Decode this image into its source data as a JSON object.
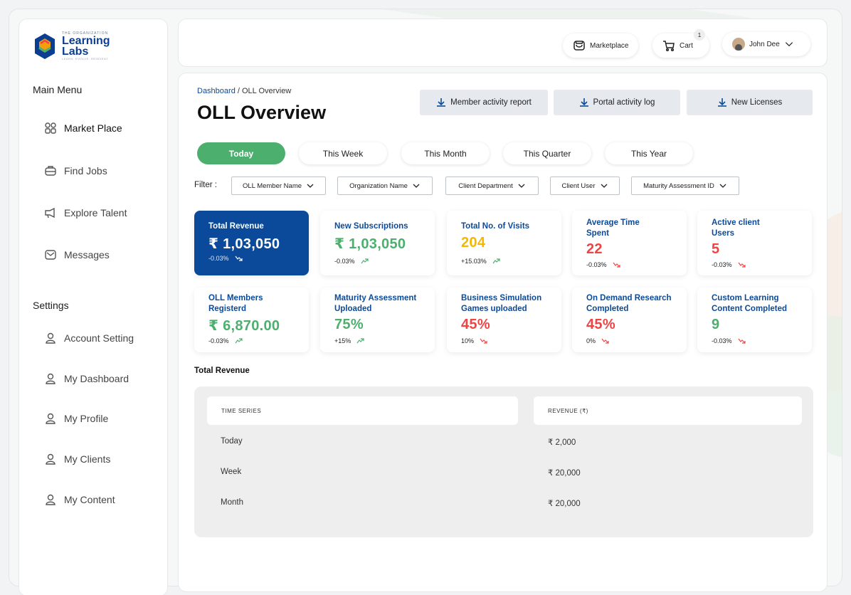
{
  "brand": {
    "small": "THE ORGANIZATION",
    "name_line1": "Learning",
    "name_line2": "Labs",
    "tagline": "LEARN. EVOLVE. REINVENT"
  },
  "sidebar": {
    "main_title": "Main Menu",
    "main_items": [
      {
        "label": "Market Place",
        "icon": "grid-icon"
      },
      {
        "label": "Find Jobs",
        "icon": "briefcase-icon"
      },
      {
        "label": "Explore Talent",
        "icon": "megaphone-icon"
      },
      {
        "label": "Messages",
        "icon": "message-icon"
      }
    ],
    "settings_title": "Settings",
    "settings_items": [
      {
        "label": "Account Setting",
        "icon": "user-icon"
      },
      {
        "label": "My Dashboard",
        "icon": "user-icon"
      },
      {
        "label": "My Profile",
        "icon": "user-icon"
      },
      {
        "label": "My Clients",
        "icon": "user-icon"
      },
      {
        "label": "My Content",
        "icon": "user-icon"
      }
    ]
  },
  "header": {
    "marketplace_label": "Marketplace",
    "cart_label": "Cart",
    "cart_count": "1",
    "user_name": "John Dee"
  },
  "main": {
    "breadcrumb_root": "Dashboard",
    "breadcrumb_sep": " / ",
    "breadcrumb_current": "OLL Overview",
    "title": "OLL Overview",
    "downloads": [
      "Member activity report",
      "Portal activity log",
      "New Licenses"
    ],
    "periods": [
      "Today",
      "This Week",
      "This Month",
      "This Quarter",
      "This Year"
    ],
    "active_period": "Today",
    "filter_label": "Filter :",
    "filters": [
      "OLL Member Name",
      "Organization Name",
      "Client Department",
      "Client User",
      "Maturity Assessment ID"
    ],
    "cards": [
      {
        "label": "Total Revenue",
        "value": "₹ 1,03,050",
        "change": "-0.03%",
        "trend": "down",
        "color": "#ffffff"
      },
      {
        "label": "New Subscriptions",
        "value": "₹ 1,03,050",
        "change": "-0.03%",
        "trend": "up",
        "color": "#4caf6e"
      },
      {
        "label": "Total No. of Visits",
        "value": "204",
        "change": "+15.03%",
        "trend": "up",
        "color": "#f5b700"
      },
      {
        "label": "Average Time Spent",
        "value": "22",
        "change": "-0.03%",
        "trend": "down",
        "color": "#ef4444"
      },
      {
        "label": "Active client Users",
        "value": "5",
        "change": "-0.03%",
        "trend": "down",
        "color": "#ef4444"
      },
      {
        "label": "OLL Members Registerd",
        "value": "₹ 6,870.00",
        "change": "-0.03%",
        "trend": "up",
        "color": "#4caf6e"
      },
      {
        "label": "Maturity Assessment Uploaded",
        "value": "75%",
        "change": "+15%",
        "trend": "up",
        "color": "#4caf6e"
      },
      {
        "label": "Business Simulation Games uploaded",
        "value": "45%",
        "change": "10%",
        "trend": "down",
        "color": "#ef4444"
      },
      {
        "label": "On Demand Research Completed",
        "value": "45%",
        "change": "0%",
        "trend": "down",
        "color": "#ef4444"
      },
      {
        "label": "Custom Learning Content Completed",
        "value": "9",
        "change": "-0.03%",
        "trend": "down",
        "color": "#4caf6e"
      }
    ],
    "revenue_title": "Total Revenue",
    "table": {
      "headers": [
        "TIME SERIES",
        "REVENUE (₹)"
      ],
      "rows": [
        [
          "Today",
          "₹ 2,000"
        ],
        [
          "Week",
          "₹ 20,000"
        ],
        [
          "Month",
          "₹ 20,000"
        ]
      ]
    }
  },
  "colors": {
    "brand_blue": "#0b4a9a",
    "active_green": "#4caf6e",
    "up_green": "#4caf6e",
    "down_red": "#ef4444"
  }
}
